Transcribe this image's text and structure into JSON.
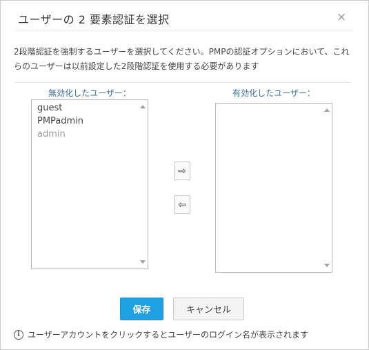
{
  "dialog": {
    "title": "ユーザーの 2 要素認証を選択",
    "close_glyph": "×",
    "description": "2段階認証を強制するユーザーを選択してください。PMPの認証オプションにおいて、これらのユーザーは以前設定した2段階認証を使用する必要があります"
  },
  "disabled_list": {
    "label": "無効化したユーザー：",
    "items": [
      "guest",
      "PMPadmin",
      "admin"
    ]
  },
  "enabled_list": {
    "label": "有効化したユーザー：",
    "items": []
  },
  "buttons": {
    "move_right_glyph": "⇨",
    "move_left_glyph": "⇦",
    "save_label": "保存",
    "cancel_label": "キャンセル"
  },
  "footer": {
    "info_glyph": "i",
    "note": "ユーザーアカウントをクリックするとユーザーのログイン名が表示されます"
  },
  "colors": {
    "accent": "#1ea1e4",
    "label_blue": "#3d6e9c"
  }
}
